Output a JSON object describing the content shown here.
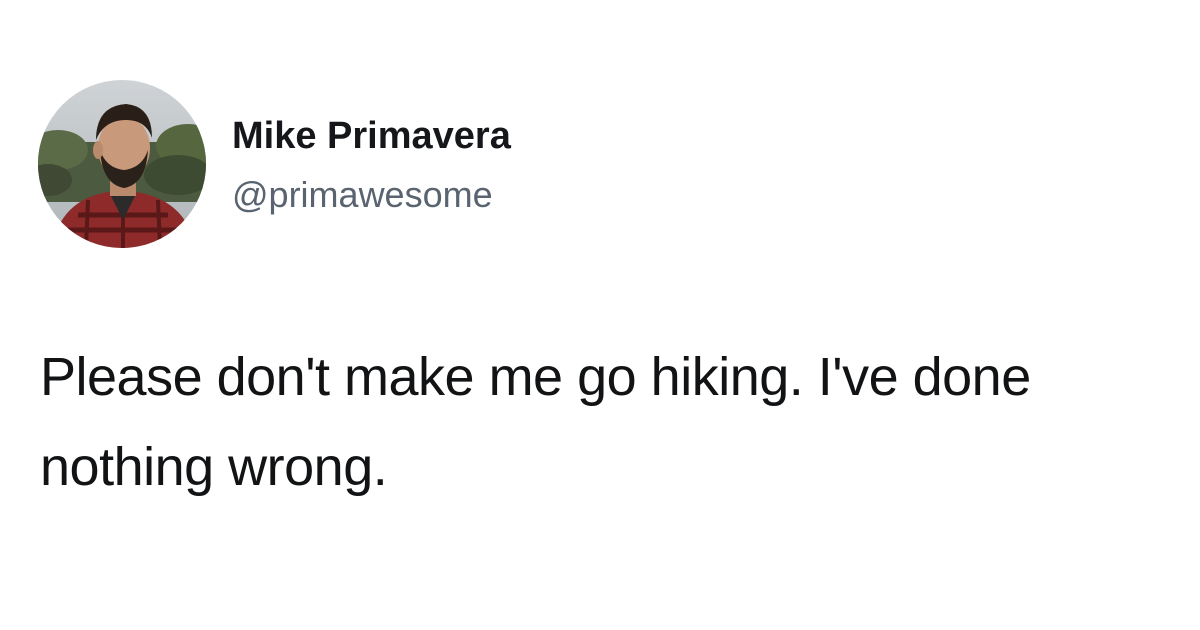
{
  "tweet": {
    "author": {
      "name": "Mike Primavera",
      "handle": "@primawesome"
    },
    "text": "Please don't make me go hiking. I've done nothing wrong."
  }
}
